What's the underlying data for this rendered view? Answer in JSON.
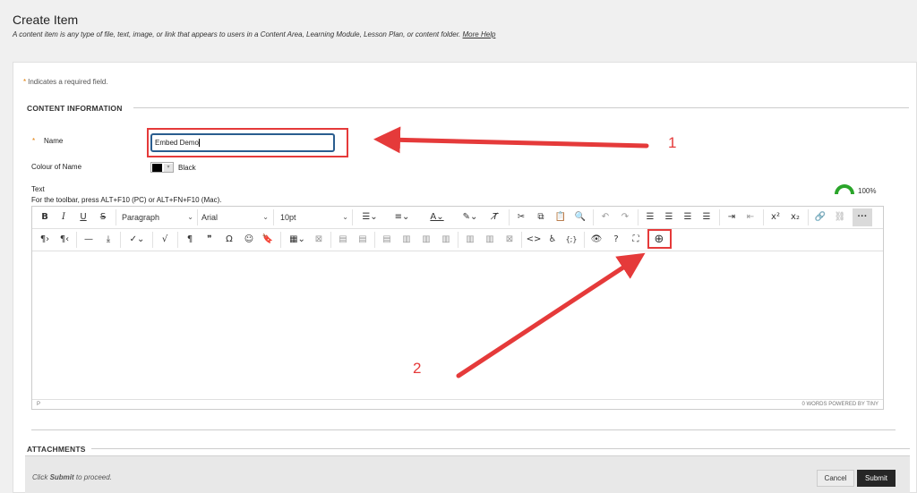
{
  "page": {
    "title": "Create Item",
    "description": "A content item is any type of file, text, image, or link that appears to users in a Content Area, Learning Module, Lesson Plan, or content folder.",
    "help_link": "More Help"
  },
  "form": {
    "required_star": "*",
    "required_note": "Indicates a required field.",
    "section_content": "CONTENT INFORMATION",
    "name_label": "Name",
    "name_value": "Embed Demo",
    "colour_label": "Colour of Name",
    "colour_value": "Black",
    "text_label": "Text",
    "toolbar_hint": "For the toolbar, press ALT+F10 (PC) or ALT+FN+F10 (Mac).",
    "accessibility_score": "100%",
    "section_attachments": "ATTACHMENTS"
  },
  "editor": {
    "block_format": "Paragraph",
    "font_family": "Arial",
    "font_size": "10pt",
    "status_path": "P",
    "status_words": "0 WORDS",
    "status_powered": "POWERED BY TINY",
    "icons_row1": [
      "bold-icon",
      "italic-icon",
      "underline-icon",
      "strikethrough-icon",
      "bullet-list-icon",
      "numbered-list-icon",
      "font-color-icon",
      "highlight-icon",
      "clear-format-icon",
      "cut-icon",
      "copy-icon",
      "paste-icon",
      "find-icon",
      "undo-icon",
      "redo-icon",
      "align-left-icon",
      "align-center-icon",
      "align-right-icon",
      "justify-icon",
      "indent-icon",
      "outdent-icon",
      "superscript-icon",
      "subscript-icon",
      "link-icon",
      "unlink-icon",
      "more-icon"
    ],
    "icons_row2": [
      "ltr-icon",
      "rtl-icon",
      "horizontal-line-icon",
      "insert-icon",
      "spellcheck-icon",
      "math-icon",
      "paragraph-icon",
      "blockquote-icon",
      "special-char-icon",
      "emoji-icon",
      "bookmark-icon",
      "table-icon",
      "table-delete-icon",
      "code-icon",
      "accessibility-icon",
      "template-icon",
      "preview-icon",
      "help-icon",
      "fullscreen-icon",
      "add-content-icon"
    ]
  },
  "annotations": {
    "label_1": "1",
    "label_2": "2",
    "color": "#e53a3a"
  },
  "footer": {
    "message_prefix": "Click ",
    "message_bold": "Submit",
    "message_suffix": " to proceed.",
    "cancel_label": "Cancel",
    "submit_label": "Submit"
  }
}
